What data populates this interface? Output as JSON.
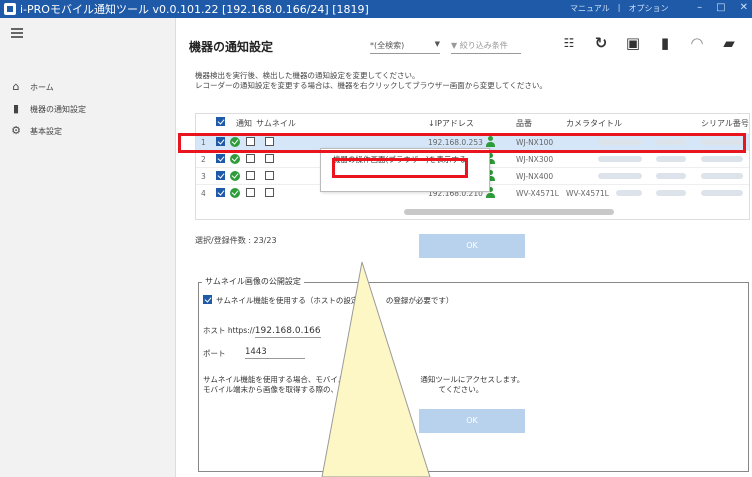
{
  "window": {
    "title": "i-PROモバイル通知ツール v0.0.101.22 [192.168.0.166/24] [1819]",
    "menu": [
      "マニュアル",
      "オプション"
    ],
    "controls": [
      "–",
      "□",
      "✕"
    ]
  },
  "sidebar": {
    "items": [
      {
        "label": "ホーム",
        "icon": "home-icon"
      },
      {
        "label": "機器の通知設定",
        "icon": "device-settings-icon"
      },
      {
        "label": "基本設定",
        "icon": "gear-icon"
      }
    ]
  },
  "header": {
    "title": "機器の通知設定",
    "filter_select": "*(全検索)",
    "filter_placeholder": "絞り込み条件"
  },
  "description": [
    "機器検出を実行後、検出した機器の通知設定を変更してください。",
    "レコーダーの通知設定を変更する場合は、機器を右クリックしてブラウザー画面から変更してください。"
  ],
  "table": {
    "columns": {
      "notify": "通知",
      "thumbnail": "サムネイル",
      "ip": "↓IPアドレス",
      "model": "品番",
      "camera_title": "カメラタイトル",
      "serial": "シリアル番号"
    },
    "rows": [
      {
        "index": "1",
        "checked": true,
        "ok": true,
        "ip": "192.168.0.253",
        "model": "WJ-NX100",
        "camera_title": ""
      },
      {
        "index": "2",
        "checked": true,
        "ok": true,
        "ip": "",
        "model": "WJ-NX300",
        "camera_title": ""
      },
      {
        "index": "3",
        "checked": true,
        "ok": true,
        "ip": "",
        "model": "WJ-NX400",
        "camera_title": ""
      },
      {
        "index": "4",
        "checked": true,
        "ok": true,
        "ip": "192.168.0.210",
        "model": "WV-X4571L",
        "camera_title": "WV-X4571L"
      }
    ]
  },
  "context_menu": {
    "item": "機器の操作画面(ブラウザー)を表示する"
  },
  "count": "選択/登録件数 : 23/23",
  "ok_label": "OK",
  "thumbnail_settings": {
    "legend": "サムネイル画像の公開設定",
    "checkbox_label": "サムネイル機能を使用する（ホストの設定と",
    "checkbox_label_tail": "の登録が必要です）",
    "host_label": "ホスト https://",
    "host_value": "192.168.0.166",
    "port_label": "ポート",
    "port_value": "1443",
    "note_line1_a": "サムネイル機能を使用する場合、モバイル端末",
    "note_line1_b": "通知ツールにアクセスします。",
    "note_line2_a": "モバイル端末から画像を取得する際の、ホスト",
    "note_line2_b": "てください。"
  },
  "colors": {
    "titlebar": "#1e5aa8",
    "highlight": "#e8141e",
    "callout": "#fdf7c5",
    "ok_button": "#b8d2ee",
    "status_green": "#2e9c3a"
  }
}
